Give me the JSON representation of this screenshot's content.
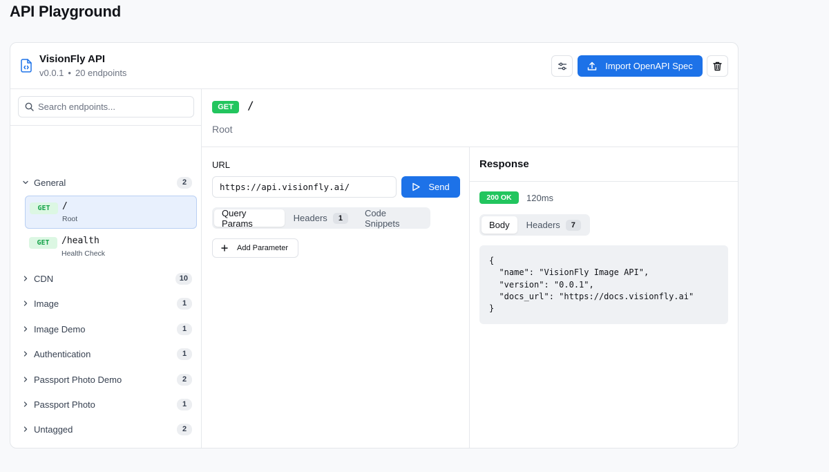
{
  "page": {
    "title": "API Playground"
  },
  "api": {
    "name": "VisionFly API",
    "version": "v0.0.1",
    "separator": "•",
    "endpoints_count": "20 endpoints"
  },
  "toolbar": {
    "import_label": "Import OpenAPI Spec"
  },
  "sidebar": {
    "search_placeholder": "Search endpoints...",
    "groups": [
      {
        "label": "General",
        "count": "2",
        "expanded": true
      },
      {
        "label": "CDN",
        "count": "10"
      },
      {
        "label": "Image",
        "count": "1"
      },
      {
        "label": "Image Demo",
        "count": "1"
      },
      {
        "label": "Authentication",
        "count": "1"
      },
      {
        "label": "Passport Photo Demo",
        "count": "2"
      },
      {
        "label": "Passport Photo",
        "count": "1"
      },
      {
        "label": "Untagged",
        "count": "2"
      }
    ],
    "general_endpoints": [
      {
        "method": "GET",
        "path": "/",
        "description": "Root",
        "selected": true
      },
      {
        "method": "GET",
        "path": "/health",
        "description": "Health Check"
      }
    ]
  },
  "endpoint": {
    "method": "GET",
    "path": "/",
    "summary": "Root"
  },
  "request": {
    "url_label": "URL",
    "url": "https://api.visionfly.ai/",
    "send_label": "Send",
    "tabs": [
      {
        "label": "Query Params",
        "active": true
      },
      {
        "label": "Headers",
        "count": "1"
      },
      {
        "label": "Code Snippets"
      }
    ],
    "add_parameter_label": "Add Parameter"
  },
  "response": {
    "title": "Response",
    "status": "200 OK",
    "time": "120ms",
    "tabs": [
      {
        "label": "Body",
        "active": true
      },
      {
        "label": "Headers",
        "count": "7"
      }
    ],
    "body": "{\n  \"name\": \"VisionFly Image API\",\n  \"version\": \"0.0.1\",\n  \"docs_url\": \"https://docs.visionfly.ai\"\n}"
  },
  "colors": {
    "primary": "#1d72e8",
    "success": "#22c55e",
    "get_badge_bg": "#dcf7e3",
    "get_badge_text": "#16a34a",
    "selected_bg": "#e8f0fd"
  }
}
